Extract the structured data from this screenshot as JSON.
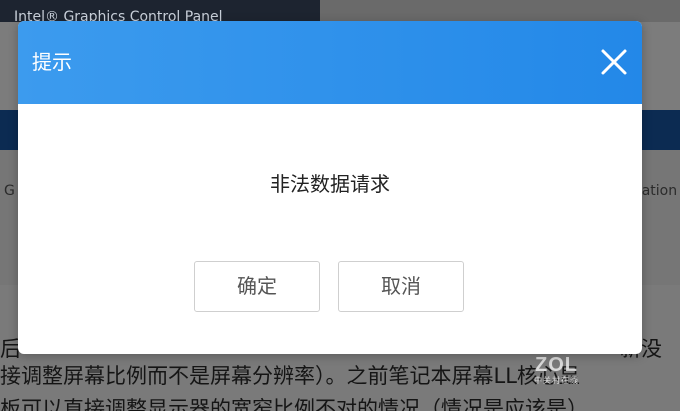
{
  "background": {
    "window_title": "Intel® Graphics Control Panel",
    "panel_left_text": "G",
    "panel_right_text": "cation",
    "article_lines": [
      "后",
      "新没",
      "接调整屏幕比例而不是屏幕分辨率）。之前笔记本屏幕LL核心显",
      "板可以直接调整显示器的宽窄比例不对的情况（情况是应该是）"
    ],
    "watermark_logo": "ZOL",
    "watermark_sub": "中关村在线"
  },
  "dialog": {
    "title": "提示",
    "message": "非法数据请求",
    "ok_label": "确定",
    "cancel_label": "取消"
  },
  "colors": {
    "header_blue": "#2388e8",
    "nav_dark_blue": "#0c2b52",
    "overlay_gray": "#7f7f7f"
  },
  "icons": {
    "close": "close-icon"
  }
}
